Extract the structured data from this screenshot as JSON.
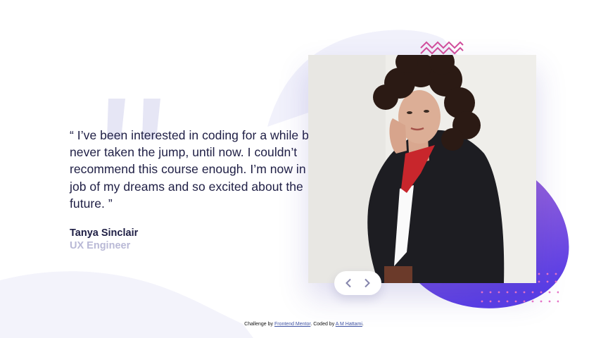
{
  "testimonial": {
    "quote": "“ I’ve been interested in coding for a while but never taken the jump, until now. I couldn’t recommend this course enough. I’m now in the job of my dreams and so excited about the future. ”",
    "author": "Tanya Sinclair",
    "role": "UX Engineer"
  },
  "attribution": {
    "prefix": "Challenge by ",
    "challenge_link": "Frontend Mentor",
    "middle": ". Coded by ",
    "author_link": "A M Hattami",
    "suffix": "."
  },
  "icons": {
    "prev": "chevron-left-icon",
    "next": "chevron-right-icon",
    "quote": "quote-icon"
  },
  "colors": {
    "dark_navy": "#202046",
    "grayish_blue": "#b9b9d6",
    "light_bg": "#f2f2fb",
    "blob_purple_start": "#a269d8",
    "blob_purple_end": "#5a3ee6",
    "accent_pink": "#d04d9b"
  }
}
